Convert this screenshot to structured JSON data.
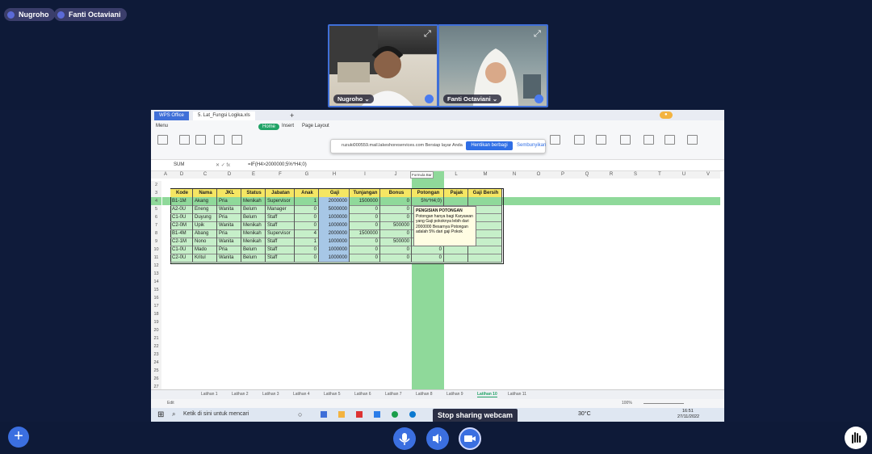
{
  "participants": [
    {
      "name": "Nugroho"
    },
    {
      "name": "Fanti Octaviani"
    }
  ],
  "tiles": [
    {
      "name": "Nugroho ⌄"
    },
    {
      "name": "Fanti Octaviani ⌄"
    }
  ],
  "spreadsheet": {
    "tab_left": "WPS Office",
    "tab_file": "5. Lat_Fungsi Logika.xls",
    "ribbon_tabs": [
      "Menu",
      "Home",
      "Insert",
      "Page Layout"
    ],
    "share_prompt": {
      "url": "ruzuki000559.mail.lakeshoreservices.com Bersiap layar Anda",
      "primary": "Hentikan berbagi",
      "secondary": "Sembunyikan"
    },
    "formula_bar": {
      "name_box": "SUM",
      "formula": "=IF(H4>2000000;5%*H4;0)"
    },
    "columns": [
      "A",
      "B",
      "C",
      "D",
      "E",
      "F",
      "G",
      "H",
      "I",
      "J",
      "K",
      "L",
      "M",
      "N",
      "O",
      "P",
      "Q",
      "R",
      "S",
      "T",
      "U",
      "V"
    ],
    "table_headers": [
      "Kode",
      "Nama",
      "JKL",
      "Status",
      "Jabatan",
      "Anak",
      "Gaji",
      "Tunjangan",
      "Bonus",
      "Potongan",
      "Pajak",
      "Gaji Bersih"
    ],
    "rows": [
      [
        "B1-1M",
        "Akang",
        "Pria",
        "Menikah",
        "Supervisor",
        "1",
        "2000000",
        "1500000",
        "0",
        "5%*H4;0)",
        "",
        ""
      ],
      [
        "A2-0U",
        "Eneng",
        "Wanita",
        "Belum",
        "Manager",
        "0",
        "5000000",
        "0",
        "0",
        "",
        "",
        ""
      ],
      [
        "C1-0U",
        "Duyung",
        "Pria",
        "Belum",
        "Staff",
        "0",
        "1000000",
        "0",
        "0",
        "",
        "",
        ""
      ],
      [
        "C2-0M",
        "Upik",
        "Wanita",
        "Menikah",
        "Staff",
        "0",
        "1000000",
        "0",
        "500000",
        "",
        "",
        ""
      ],
      [
        "B1-4M",
        "Abang",
        "Pria",
        "Menikah",
        "Supervisor",
        "4",
        "2000000",
        "1500000",
        "0",
        "",
        "",
        ""
      ],
      [
        "C2-1M",
        "Nono",
        "Wanita",
        "Menikah",
        "Staff",
        "1",
        "1000000",
        "0",
        "500000",
        "0",
        "",
        ""
      ],
      [
        "C1-0U",
        "Mado",
        "Pria",
        "Belum",
        "Staff",
        "0",
        "1000000",
        "0",
        "0",
        "0",
        "",
        ""
      ],
      [
        "C2-0U",
        "Kritul",
        "Wanita",
        "Belum",
        "Staff",
        "0",
        "1000000",
        "0",
        "0",
        "0",
        "",
        ""
      ]
    ],
    "row_numbers": [
      "2",
      "3",
      "4",
      "5",
      "6",
      "7",
      "8",
      "9",
      "10",
      "11",
      "12",
      "13",
      "14",
      "15",
      "16",
      "17",
      "18",
      "19",
      "20",
      "21",
      "22",
      "23",
      "24",
      "25",
      "26",
      "27"
    ],
    "tooltip": "Formula Bar",
    "comment": {
      "title": "PENGISIAN POTONGAN",
      "body": "Potongan hanya bagi Karyawan yang Gaji pokoknya lebih dari 2000000 Besarnya Potongan adalah 5% dari gaji Pokok"
    },
    "sheet_tabs": [
      "Latihan 1",
      "Latihan 2",
      "Latihan 3",
      "Latihan 4",
      "Latihan 5",
      "Latihan 6",
      "Latihan 7",
      "Latihan 8",
      "Latihan 9",
      "Latihan 10",
      "Latihan 11"
    ],
    "active_sheet": "Latihan 10",
    "status_left": "Edit",
    "zoom": "100%",
    "taskbar_search": "Ketik di sini untuk mencari",
    "weather": "30°C",
    "clock_time": "16:51",
    "clock_date": "27/11/2022"
  },
  "bottom": {
    "stop_sharing": "Stop sharing webcam"
  },
  "colors": {
    "accent": "#3f6fd8",
    "excel_green": "#21a366",
    "highlight_row": "#8fd99a"
  }
}
